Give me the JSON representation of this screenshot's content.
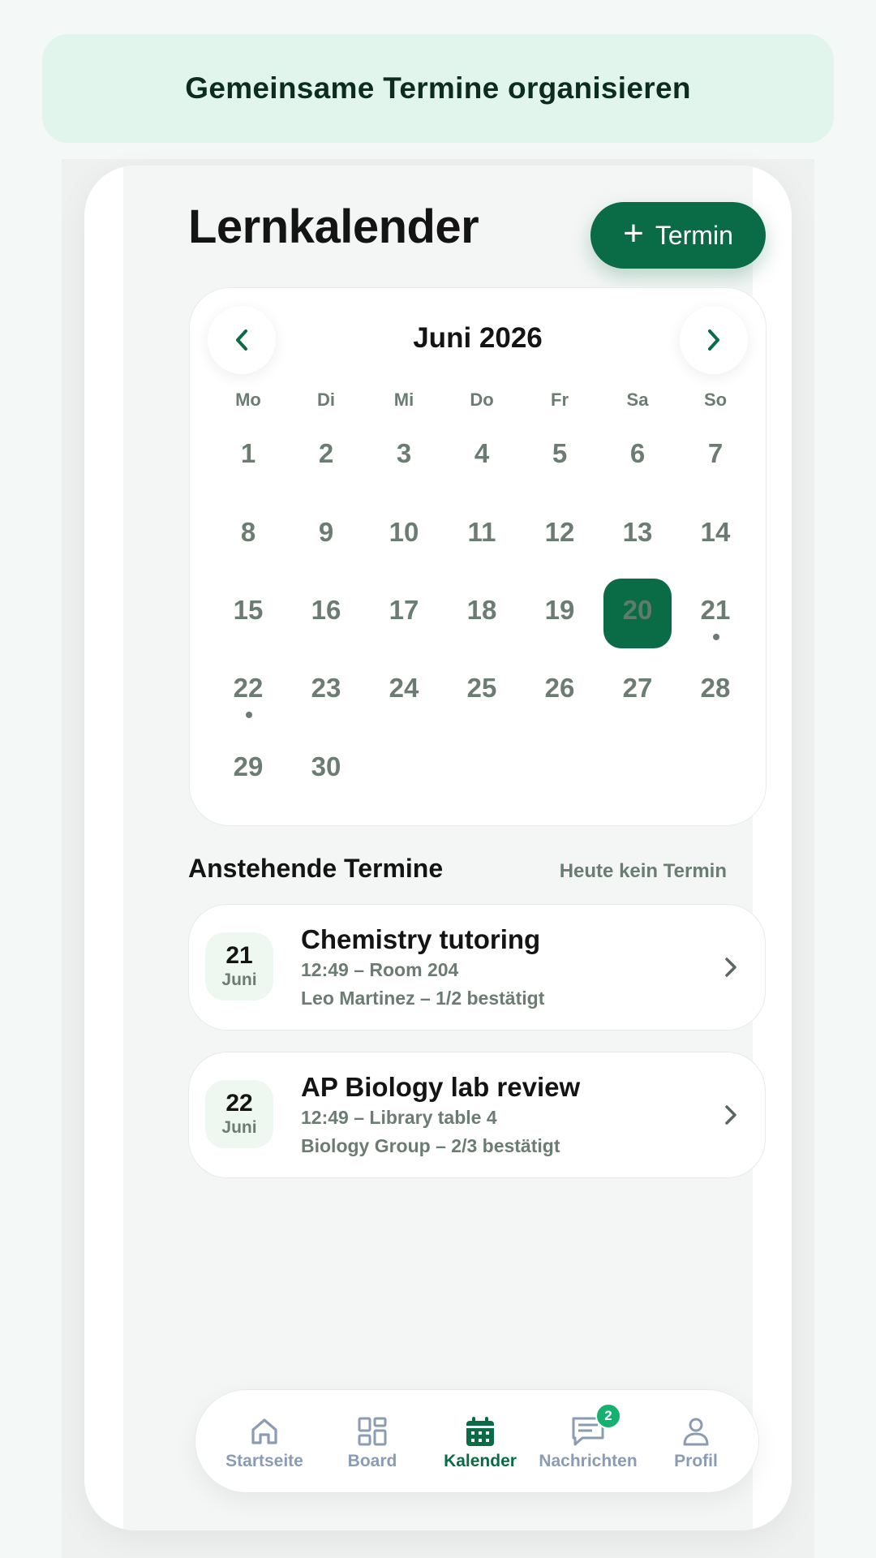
{
  "banner": {
    "text": "Gemeinsame Termine organisieren"
  },
  "header": {
    "title": "Lernkalender",
    "add_button_label": "Termin"
  },
  "calendar": {
    "month_label": "Juni 2026",
    "weekdays": [
      "Mo",
      "Di",
      "Mi",
      "Do",
      "Fr",
      "Sa",
      "So"
    ],
    "selected_day": 20,
    "days_with_events": [
      21,
      22
    ],
    "weeks": [
      [
        "1",
        "2",
        "3",
        "4",
        "5",
        "6",
        "7"
      ],
      [
        "8",
        "9",
        "10",
        "11",
        "12",
        "13",
        "14"
      ],
      [
        "15",
        "16",
        "17",
        "18",
        "19",
        "20",
        "21"
      ],
      [
        "22",
        "23",
        "24",
        "25",
        "26",
        "27",
        "28"
      ],
      [
        "29",
        "30",
        "",
        "",
        "",
        "",
        ""
      ]
    ]
  },
  "upcoming": {
    "title": "Anstehende Termine",
    "note": "Heute kein Termin",
    "events": [
      {
        "day": "21",
        "month": "Juni",
        "title": "Chemistry tutoring",
        "time_place": "12:49 – Room 204",
        "meta": "Leo Martinez – 1/2 bestätigt"
      },
      {
        "day": "22",
        "month": "Juni",
        "title": "AP Biology lab review",
        "time_place": "12:49 – Library table 4",
        "meta": "Biology Group – 2/3 bestätigt"
      }
    ]
  },
  "tabbar": {
    "tabs": [
      {
        "label": "Startseite",
        "icon": "home-icon"
      },
      {
        "label": "Board",
        "icon": "board-icon"
      },
      {
        "label": "Kalender",
        "icon": "calendar-icon",
        "active": true
      },
      {
        "label": "Nachrichten",
        "icon": "messages-icon",
        "badge": "2"
      },
      {
        "label": "Profil",
        "icon": "profile-icon"
      }
    ]
  },
  "colors": {
    "accent": "#0a6b47",
    "badge": "#17b06f",
    "banner_bg": "#e1f5ec",
    "muted": "#6b7d72"
  }
}
